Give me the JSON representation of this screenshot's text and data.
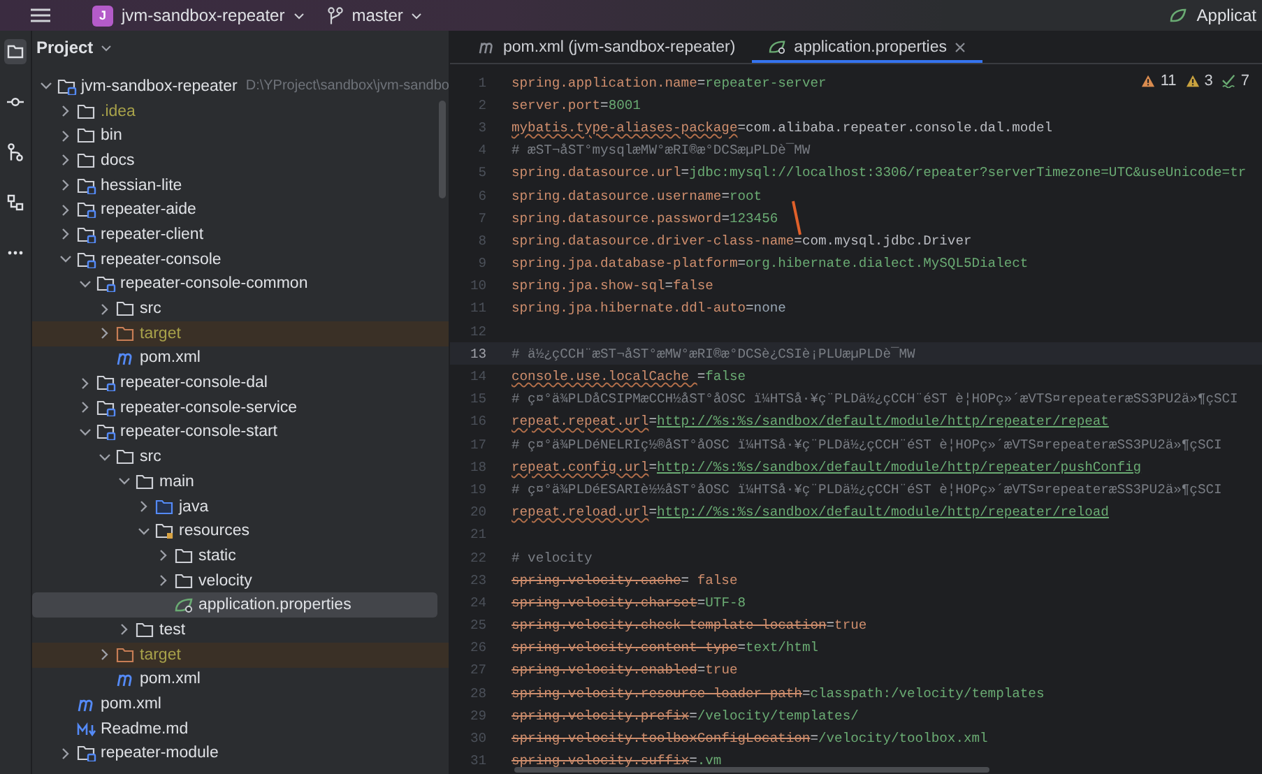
{
  "title_bar": {
    "project_badge": "J",
    "project_name": "jvm-sandbox-repeater",
    "branch": "master",
    "run_config": "Applicat"
  },
  "tool_strip": [
    {
      "kind": "project",
      "selected": true
    },
    {
      "kind": "commit",
      "selected": false
    },
    {
      "kind": "vcs",
      "selected": false
    },
    {
      "kind": "structure",
      "selected": false
    },
    {
      "kind": "more",
      "selected": false
    }
  ],
  "project_panel": {
    "title": "Project",
    "items": [
      {
        "label": "jvm-sandbox-repeater",
        "location": "D:\\YProject\\sandbox\\jvm-sandbo",
        "kind": "module",
        "expanded": true,
        "selected": false,
        "children": [
          {
            "label": ".idea",
            "kind": "folder",
            "excluded": false,
            "ignored": true,
            "expanded": false,
            "selected": false
          },
          {
            "label": "bin",
            "kind": "folder",
            "expanded": false,
            "selected": false
          },
          {
            "label": "docs",
            "kind": "folder",
            "expanded": false,
            "selected": false
          },
          {
            "label": "hessian-lite",
            "kind": "module",
            "expanded": false,
            "selected": false
          },
          {
            "label": "repeater-aide",
            "kind": "module",
            "expanded": false,
            "selected": false
          },
          {
            "label": "repeater-client",
            "kind": "module",
            "expanded": false,
            "selected": false
          },
          {
            "label": "repeater-console",
            "kind": "module",
            "expanded": true,
            "selected": false,
            "children": [
              {
                "label": "repeater-console-common",
                "kind": "module",
                "expanded": true,
                "selected": false,
                "children": [
                  {
                    "label": "src",
                    "kind": "folder",
                    "expanded": false,
                    "selected": false
                  },
                  {
                    "label": "target",
                    "kind": "folder",
                    "excluded": true,
                    "expanded": false,
                    "selected": false
                  },
                  {
                    "label": "pom.xml",
                    "kind": "pom",
                    "selected": false
                  }
                ]
              },
              {
                "label": "repeater-console-dal",
                "kind": "module",
                "expanded": false,
                "selected": false
              },
              {
                "label": "repeater-console-service",
                "kind": "module",
                "expanded": false,
                "selected": false
              },
              {
                "label": "repeater-console-start",
                "kind": "module",
                "expanded": true,
                "selected": false,
                "children": [
                  {
                    "label": "src",
                    "kind": "folder",
                    "expanded": true,
                    "selected": false,
                    "children": [
                      {
                        "label": "main",
                        "kind": "folder",
                        "expanded": true,
                        "selected": false,
                        "children": [
                          {
                            "label": "java",
                            "kind": "source-folder",
                            "expanded": false,
                            "selected": false
                          },
                          {
                            "label": "resources",
                            "kind": "resources-folder",
                            "expanded": true,
                            "selected": false,
                            "children": [
                              {
                                "label": "static",
                                "kind": "folder",
                                "expanded": false,
                                "selected": false
                              },
                              {
                                "label": "velocity",
                                "kind": "folder",
                                "expanded": false,
                                "selected": false
                              },
                              {
                                "label": "application.properties",
                                "kind": "properties",
                                "selected": true
                              }
                            ]
                          }
                        ]
                      },
                      {
                        "label": "test",
                        "kind": "folder",
                        "expanded": false,
                        "selected": false
                      }
                    ]
                  },
                  {
                    "label": "target",
                    "kind": "folder",
                    "excluded": true,
                    "expanded": false,
                    "selected": false
                  },
                  {
                    "label": "pom.xml",
                    "kind": "pom",
                    "selected": false
                  }
                ]
              }
            ]
          },
          {
            "label": "pom.xml",
            "kind": "pom",
            "selected": false
          },
          {
            "label": "Readme.md",
            "kind": "markdown",
            "selected": false
          },
          {
            "label": "repeater-module",
            "kind": "module",
            "expanded": false,
            "selected": false
          }
        ]
      }
    ]
  },
  "editor": {
    "tabs": [
      {
        "label": "pom.xml (jvm-sandbox-repeater)",
        "kind": "pom",
        "selected": false
      },
      {
        "label": "application.properties",
        "kind": "properties",
        "selected": true
      }
    ],
    "inspections": [
      {
        "kind": "error",
        "count": "11"
      },
      {
        "kind": "warning",
        "count": "3"
      },
      {
        "kind": "typo",
        "count": "7"
      }
    ],
    "lines": [
      {
        "number": "1",
        "kind": "property",
        "key": "spring.application.name",
        "separator": "=",
        "value": {
          "text": "repeater-server",
          "kind": "string"
        },
        "current": false
      },
      {
        "number": "2",
        "kind": "property",
        "key": "server.port",
        "separator": "=",
        "value": {
          "text": "8001",
          "kind": "string"
        },
        "current": false
      },
      {
        "number": "3",
        "kind": "property",
        "key": "mybatis.type-aliases-package",
        "separator": "=",
        "value": {
          "text": "com.alibaba.repeater.console.dal.model",
          "kind": "plain"
        },
        "warning": true,
        "current": false
      },
      {
        "number": "4",
        "kind": "comment",
        "text": "# æST¬åST°mysqlæMW°æRI®æ°DCSæµPLDè¯MW",
        "current": false
      },
      {
        "number": "5",
        "kind": "property",
        "key": "spring.datasource.url",
        "separator": "=",
        "value": {
          "text": "jdbc:mysql://localhost:3306/repeater?serverTimezone=UTC&useUnicode=tr",
          "kind": "string"
        },
        "current": false
      },
      {
        "number": "6",
        "kind": "property",
        "key": "spring.datasource.username",
        "separator": "=",
        "value": {
          "text": "root",
          "kind": "string"
        },
        "current": false
      },
      {
        "number": "7",
        "kind": "property",
        "key": "spring.datasource.password",
        "separator": "=",
        "value": {
          "text": "123456",
          "kind": "string"
        },
        "current": false
      },
      {
        "number": "8",
        "kind": "property",
        "key": "spring.datasource.driver-class-name",
        "separator": "=",
        "value": {
          "text": "com.mysql.jdbc.Driver",
          "kind": "plain"
        },
        "current": false
      },
      {
        "number": "9",
        "kind": "property",
        "key": "spring.jpa.database-platform",
        "separator": "=",
        "value": {
          "text": "org.hibernate.dialect.MySQL5Dialect",
          "kind": "string"
        },
        "current": false
      },
      {
        "number": "10",
        "kind": "property",
        "key": "spring.jpa.show-sql",
        "separator": "=",
        "value": {
          "text": "false",
          "kind": "keyword"
        },
        "current": false
      },
      {
        "number": "11",
        "kind": "property",
        "key": "spring.jpa.hibernate.ddl-auto",
        "separator": "=",
        "value": {
          "text": "none",
          "kind": "constant"
        },
        "current": false
      },
      {
        "number": "12",
        "kind": "blank",
        "current": false
      },
      {
        "number": "13",
        "kind": "comment",
        "text": "# ä½¿çCCH¨æST¬åST°æMW°æRI®æ°DCSè¿CSIè¡PLUæµPLDè¯MW",
        "current": true
      },
      {
        "number": "14",
        "kind": "property",
        "key": "console.use.localCache ",
        "separator": "=",
        "value": {
          "text": "false",
          "kind": "string"
        },
        "warning": true,
        "current": false
      },
      {
        "number": "15",
        "kind": "comment",
        "text": "# ç¤°ä¾PLDåCSIPMæCCH½åST°åOSC ï¼HTSå·¥ç¨PLDä½¿çCCH¨éST è¦HOPç»´æVTS¤repeateræSS3PU2ä»¶çSCI",
        "current": false
      },
      {
        "number": "16",
        "kind": "property",
        "key": "repeat.repeat.url",
        "separator": "=",
        "value": {
          "text": "http://%s:%s/sandbox/default/module/http/repeater/repeat",
          "kind": "link"
        },
        "warning": true,
        "current": false
      },
      {
        "number": "17",
        "kind": "comment",
        "text": "# ç¤°ä¾PLDéNELRIç½®åST°åOSC ï¼HTSå·¥ç¨PLDä½¿çCCH¨éST è¦HOPç»´æVTS¤repeateræSS3PU2ä»¶çSCI",
        "current": false
      },
      {
        "number": "18",
        "kind": "property",
        "key": "repeat.config.url",
        "separator": "=",
        "value": {
          "text": "http://%s:%s/sandbox/default/module/http/repeater/pushConfig",
          "kind": "link"
        },
        "warning": true,
        "current": false
      },
      {
        "number": "19",
        "kind": "comment",
        "text": "# ç¤°ä¾PLDéESARIè½½åST°åOSC ï¼HTSå·¥ç¨PLDä½¿çCCH¨éST è¦HOPç»´æVTS¤repeateræSS3PU2ä»¶çSCI",
        "current": false
      },
      {
        "number": "20",
        "kind": "property",
        "key": "repeat.reload.url",
        "separator": "=",
        "value": {
          "text": "http://%s:%s/sandbox/default/module/http/repeater/reload",
          "kind": "link"
        },
        "warning": true,
        "current": false
      },
      {
        "number": "21",
        "kind": "blank",
        "current": false
      },
      {
        "number": "22",
        "kind": "comment",
        "text": "# velocity",
        "current": false
      },
      {
        "number": "23",
        "kind": "property",
        "key": "spring.velocity.cache",
        "separator": "=",
        "value": {
          "text": " false",
          "kind": "keyword"
        },
        "deprecated": true,
        "current": false
      },
      {
        "number": "24",
        "kind": "property",
        "key": "spring.velocity.charset",
        "separator": "=",
        "value": {
          "text": "UTF-8",
          "kind": "string"
        },
        "deprecated": true,
        "current": false
      },
      {
        "number": "25",
        "kind": "property",
        "key": "spring.velocity.check-template-location",
        "separator": "=",
        "value": {
          "text": "true",
          "kind": "keyword"
        },
        "deprecated": true,
        "current": false
      },
      {
        "number": "26",
        "kind": "property",
        "key": "spring.velocity.content-type",
        "separator": "=",
        "value": {
          "text": "text/html",
          "kind": "string"
        },
        "deprecated": true,
        "current": false
      },
      {
        "number": "27",
        "kind": "property",
        "key": "spring.velocity.enabled",
        "separator": "=",
        "value": {
          "text": "true",
          "kind": "keyword"
        },
        "deprecated": true,
        "current": false
      },
      {
        "number": "28",
        "kind": "property",
        "key": "spring.velocity.resource-loader-path",
        "separator": "=",
        "value": {
          "text": "classpath:/velocity/templates",
          "kind": "string"
        },
        "deprecated": true,
        "current": false
      },
      {
        "number": "29",
        "kind": "property",
        "key": "spring.velocity.prefix",
        "separator": "=",
        "value": {
          "text": "/velocity/templates/",
          "kind": "string"
        },
        "deprecated": true,
        "current": false
      },
      {
        "number": "30",
        "kind": "property",
        "key": "spring.velocity.toolboxConfigLocation",
        "separator": "=",
        "value": {
          "text": "/velocity/toolbox.xml",
          "kind": "string"
        },
        "deprecated": true,
        "current": false
      },
      {
        "number": "31",
        "kind": "property",
        "key": "spring.velocity.suffix",
        "separator": "=",
        "value": {
          "text": ".vm",
          "kind": "string"
        },
        "deprecated": true,
        "current": false
      }
    ]
  }
}
